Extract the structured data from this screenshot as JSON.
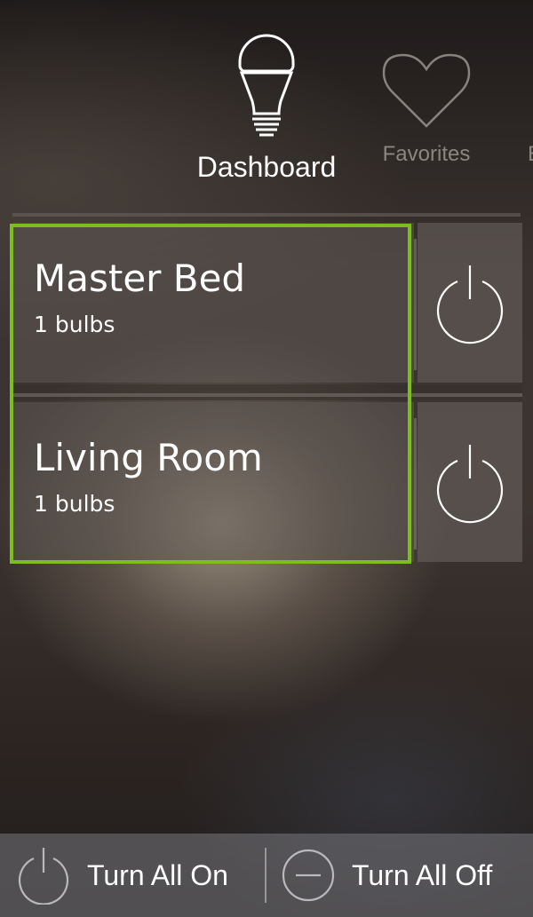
{
  "tabs": {
    "dashboard": {
      "label": "Dashboard",
      "icon": "bulb-icon"
    },
    "favorites": {
      "label": "Favorites",
      "icon": "heart-icon"
    },
    "partial": {
      "label": "E"
    }
  },
  "rooms": [
    {
      "name": "Master Bed",
      "count": "1 bulbs",
      "power_icon": "power-icon"
    },
    {
      "name": "Living Room",
      "count": "1 bulbs",
      "power_icon": "power-icon"
    }
  ],
  "bottom_bar": {
    "turn_all_on": {
      "label": "Turn All On",
      "icon": "power-icon"
    },
    "turn_all_off": {
      "label": "Turn All Off",
      "icon": "minus-circle-icon"
    }
  },
  "colors": {
    "highlight": "#7bbf1e",
    "text": "#ffffff"
  }
}
